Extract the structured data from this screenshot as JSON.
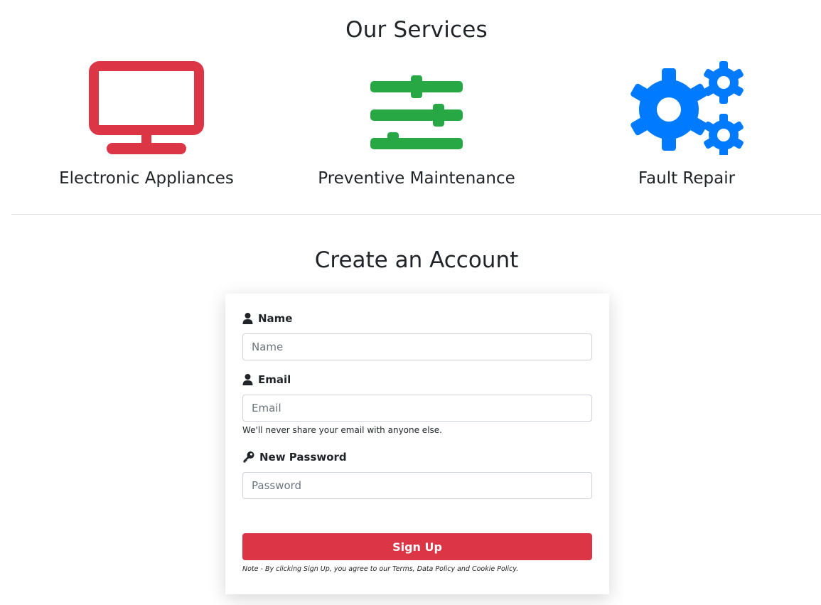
{
  "services": {
    "title": "Our Services",
    "items": [
      {
        "label": "Electronic Appliances",
        "icon": "monitor-icon",
        "color": "#dc3545"
      },
      {
        "label": "Preventive Maintenance",
        "icon": "sliders-icon",
        "color": "#28a745"
      },
      {
        "label": "Fault Repair",
        "icon": "cogs-icon",
        "color": "#007bff"
      }
    ]
  },
  "account": {
    "title": "Create an Account",
    "name": {
      "label": "Name",
      "placeholder": "Name",
      "icon": "user-icon"
    },
    "email": {
      "label": "Email",
      "placeholder": "Email",
      "help": "We'll never share your email with anyone else.",
      "icon": "user-icon"
    },
    "password": {
      "label": "New Password",
      "placeholder": "Password",
      "icon": "key-icon"
    },
    "submit_label": "Sign Up",
    "note": "Note - By clicking Sign Up, you agree to our Terms, Data Policy and Cookie Policy.",
    "button_color": "#dc3545"
  }
}
